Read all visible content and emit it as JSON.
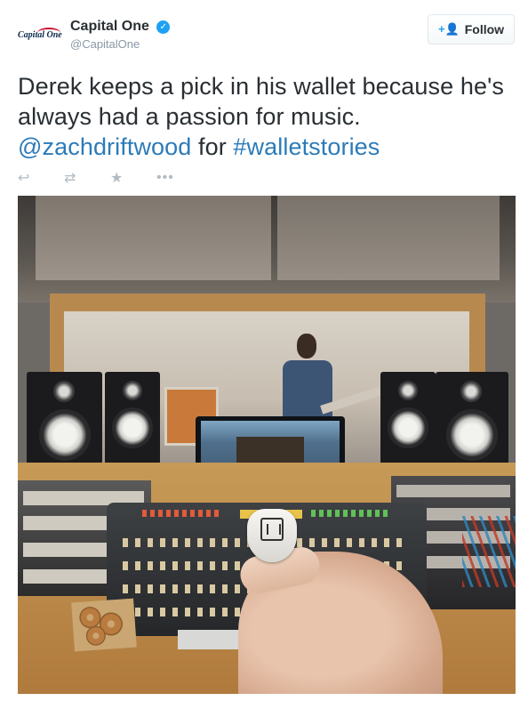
{
  "account": {
    "logo_text": "Capital One",
    "name": "Capital One",
    "handle": "@CapitalOne",
    "verified_mark": "✓"
  },
  "follow": {
    "icon": "+👤",
    "label": "Follow"
  },
  "tweet": {
    "text_before": "Derek keeps a pick in his wallet because he's always had a passion for music. ",
    "mention": "@zachdriftwood",
    "text_middle": " for ",
    "hashtag": "#walletstories"
  },
  "actions": {
    "reply": "↩",
    "retweet": "⇄",
    "favorite": "★",
    "more": "•••"
  },
  "colors": {
    "link": "#2b7bb9",
    "verified": "#1da1f2",
    "action_icons": "#b1bbc3"
  }
}
